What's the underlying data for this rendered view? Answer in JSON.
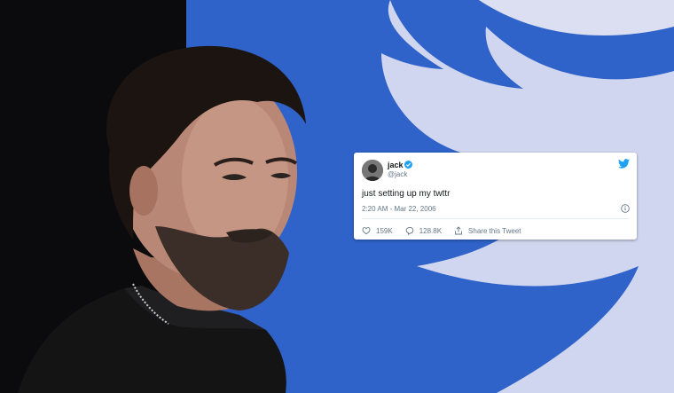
{
  "tweet": {
    "name": "jack",
    "handle": "@jack",
    "text": "just setting up my twttr",
    "timestamp": "2:20 AM - Mar 22, 2006",
    "likes": "159K",
    "retweets": "128.8K",
    "share_label": "Share this Tweet"
  },
  "colors": {
    "background_blue": "#2f63c9",
    "twitter_blue": "#1da1f2",
    "text_primary": "#14171a",
    "text_secondary": "#657786"
  },
  "icons": [
    "twitter-bird-icon",
    "verified-badge-icon",
    "info-icon",
    "heart-icon",
    "reply-icon",
    "share-icon"
  ]
}
